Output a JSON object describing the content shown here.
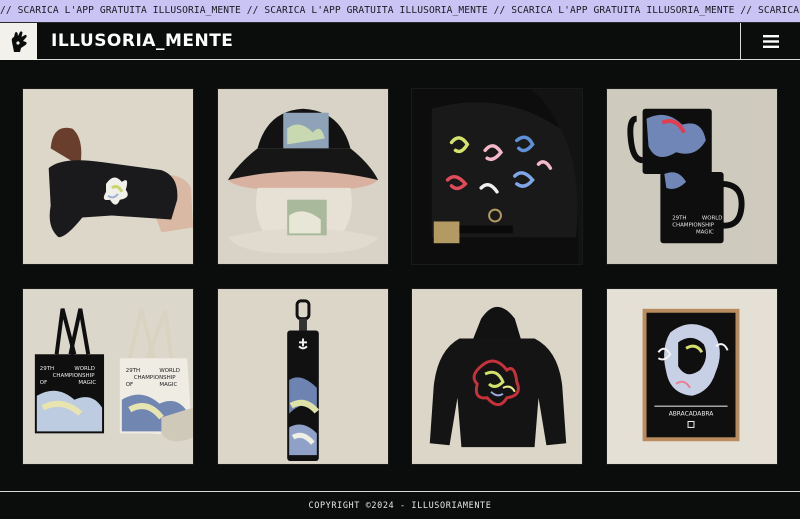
{
  "marquee": {
    "text": "// SCARICA L'APP GRATUITA ILLUSORIA_MENTE // SCARICA L'APP GRATUITA ILLUSORIA_MENTE // SCARICA L'APP GRATUITA ILLUSORIA_MENTE // SCARICA L'APP GRATUITA ILLUSORIA_MENTE // SCARICA L'APP GRATUITA"
  },
  "header": {
    "title": "ILLUSORIA_MENTE",
    "logo_icon": "hand-logo-icon",
    "menu_icon": "hamburger-menu-icon"
  },
  "products": {
    "items": [
      {
        "icon": "hoodie-model-photo"
      },
      {
        "icon": "bucket-hat-photo"
      },
      {
        "icon": "cap-with-pins-photo"
      },
      {
        "icon": "mugs-photo",
        "print_text": [
          "29TH",
          "WORLD",
          "CHAMPIONSHIP",
          "MAGIC"
        ]
      },
      {
        "icon": "tote-bags-photo",
        "print_text": [
          "29TH",
          "WORLD",
          "CHAMPIONSHIP",
          "OF",
          "MAGIC"
        ]
      },
      {
        "icon": "keychain-strap-photo"
      },
      {
        "icon": "hoodie-back-photo"
      },
      {
        "icon": "framed-poster-photo",
        "print_text": [
          "ABRACADABRA"
        ]
      }
    ]
  },
  "footer": {
    "copyright": "COPYRIGHT ©2024 - ILLUSORIAMENTE"
  },
  "colors": {
    "background": "#0b0c0c",
    "marquee_bg": "#c9c4f3",
    "tile_bg": "#dcd7cb"
  }
}
